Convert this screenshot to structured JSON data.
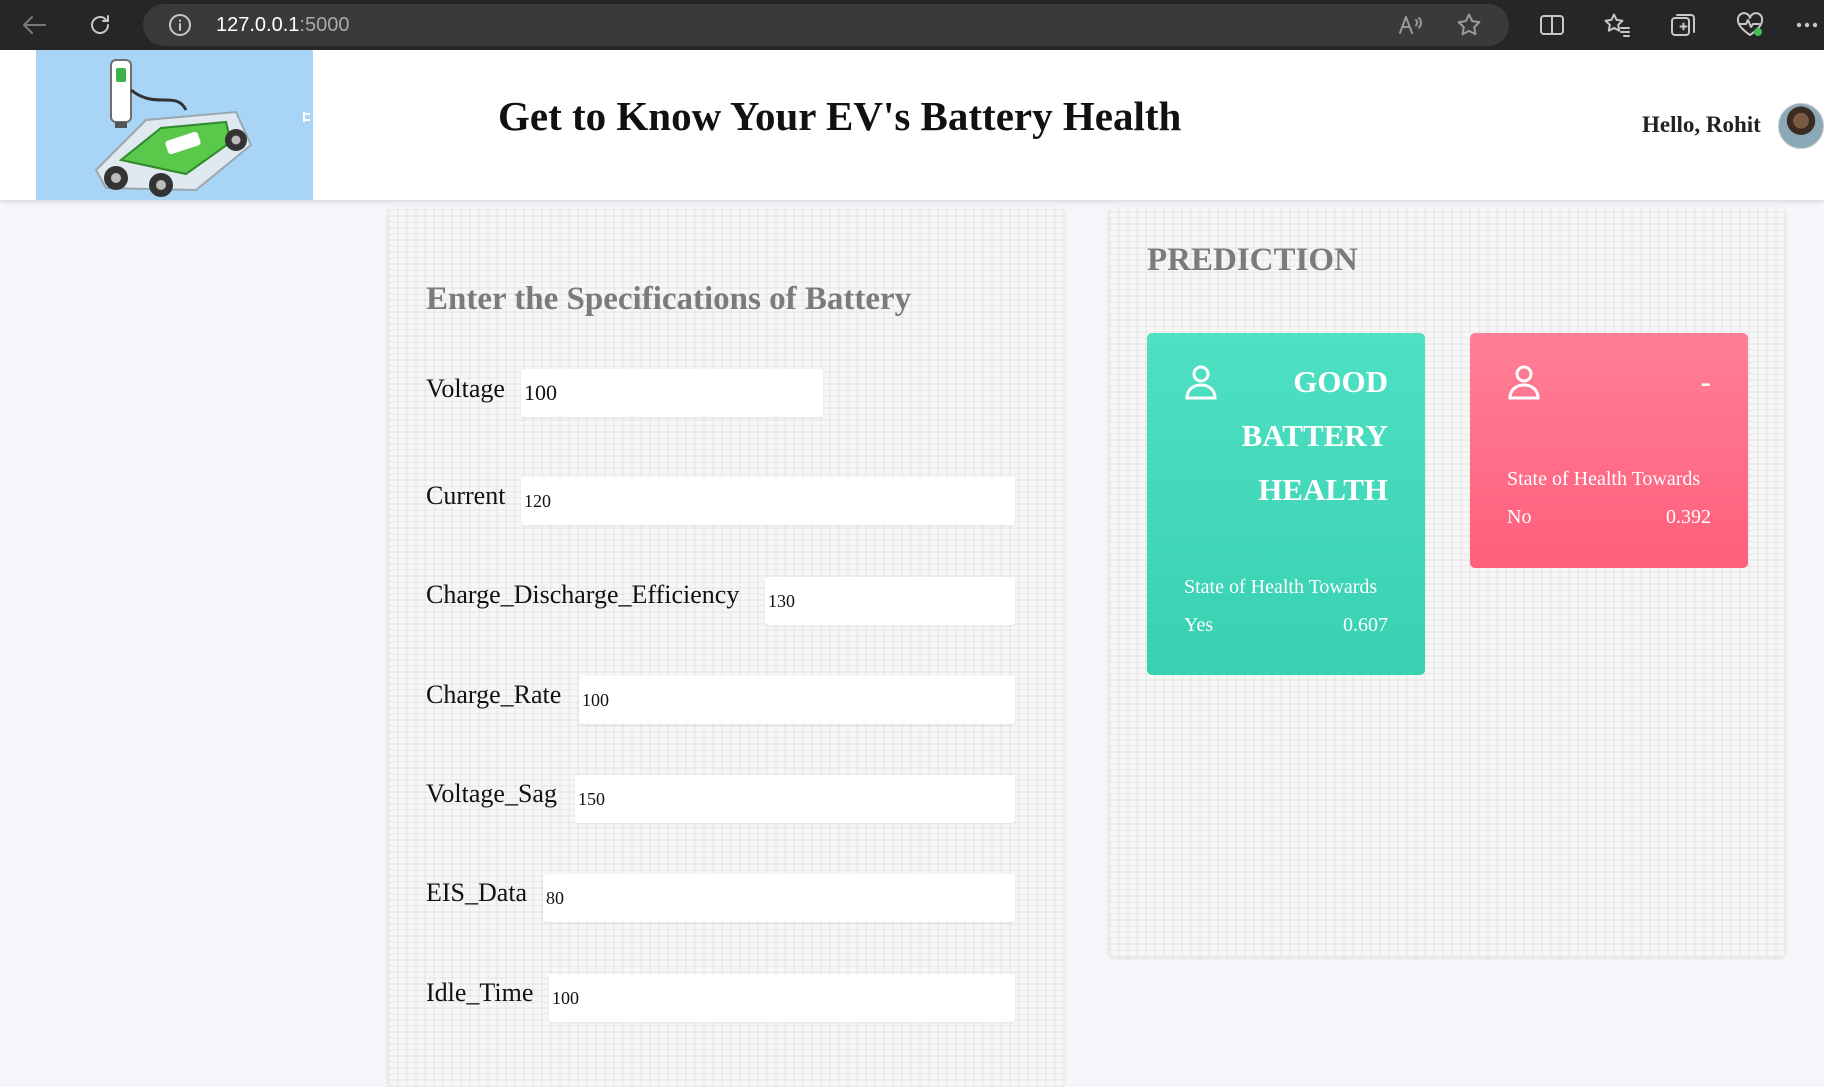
{
  "browser": {
    "url_host": "127.0.0.1",
    "url_port": ":5000"
  },
  "header": {
    "title": "Get to Know Your EV's Battery Health",
    "greeting": "Hello, Rohit"
  },
  "form": {
    "title": "Enter the Specifications of Battery",
    "fields": [
      {
        "label": "Voltage",
        "value": "100"
      },
      {
        "label": "Current",
        "value": "120"
      },
      {
        "label": "Charge_Discharge_Efficiency",
        "value": "130"
      },
      {
        "label": "Charge_Rate",
        "value": "100"
      },
      {
        "label": "Voltage_Sag",
        "value": "150"
      },
      {
        "label": "EIS_Data",
        "value": "80"
      },
      {
        "label": "Idle_Time",
        "value": "100"
      }
    ]
  },
  "prediction": {
    "title": "PREDICTION",
    "good_card": {
      "status_lines": [
        "GOOD",
        "BATTERY",
        "HEALTH"
      ],
      "soh_label": "State of Health Towards",
      "soh_class": "Yes",
      "soh_value": "0.607",
      "color": "#3fd8b8"
    },
    "bad_card": {
      "status": "-",
      "soh_label": "State of Health Towards",
      "soh_class": "No",
      "soh_value": "0.392",
      "color": "#ff6b86"
    }
  }
}
